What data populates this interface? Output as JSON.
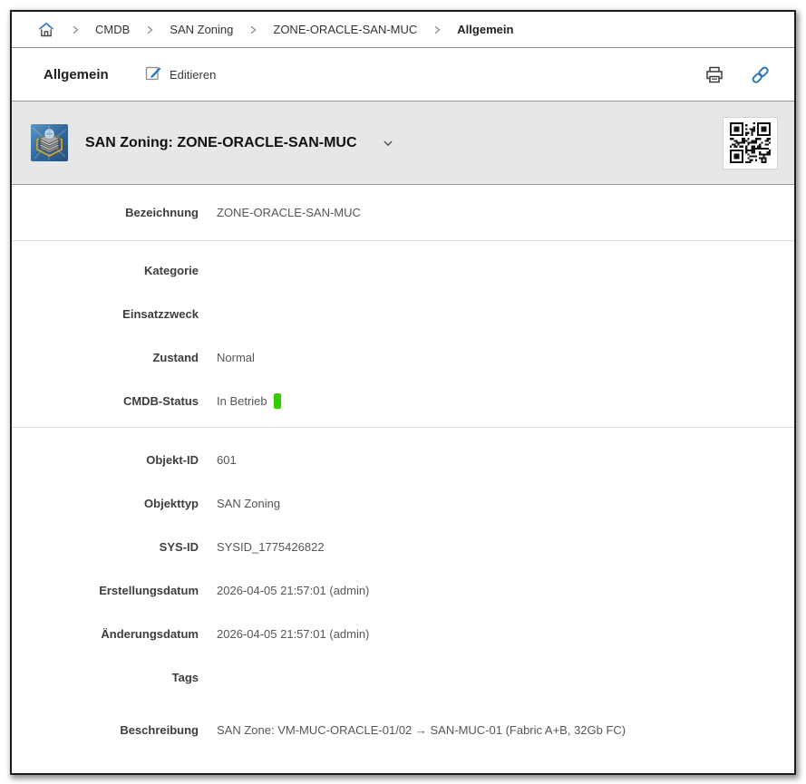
{
  "breadcrumb": {
    "items": [
      "CMDB",
      "SAN Zoning",
      "ZONE-ORACLE-SAN-MUC",
      "Allgemein"
    ]
  },
  "header": {
    "title": "Allgemein",
    "edit_label": "Editieren"
  },
  "object_header": {
    "title": "SAN Zoning: ZONE-ORACLE-SAN-MUC",
    "icons": [
      "object-type-icon",
      "chevron-down-icon",
      "qr-code"
    ]
  },
  "colors": {
    "status_badge_green": "#33cc00",
    "accent_blue": "#2a72b8",
    "band_gray": "#e7e7e7"
  },
  "form": {
    "sections": [
      {
        "rows": [
          {
            "label": "Bezeichnung",
            "value": "ZONE-ORACLE-SAN-MUC"
          }
        ]
      },
      {
        "rows": [
          {
            "label": "Kategorie",
            "value": ""
          },
          {
            "label": "Einsatzzweck",
            "value": ""
          },
          {
            "label": "Zustand",
            "value": "Normal"
          },
          {
            "label": "CMDB-Status",
            "value": "In Betrieb",
            "badge_color": "#33cc00"
          }
        ]
      },
      {
        "rows": [
          {
            "label": "Objekt-ID",
            "value": "601"
          },
          {
            "label": "Objekttyp",
            "value": "SAN Zoning"
          },
          {
            "label": "SYS-ID",
            "value": "SYSID_1775426822"
          },
          {
            "label": "Erstellungsdatum",
            "value": "2026-04-05 21:57:01 (admin)"
          },
          {
            "label": "Änderungsdatum",
            "value": "2026-04-05 21:57:01 (admin)"
          },
          {
            "label": "Tags",
            "value": ""
          },
          {
            "label": "Beschreibung",
            "value": "SAN Zone: VM-MUC-ORACLE-01/02 → SAN-MUC-01 (Fabric A+B, 32Gb FC)"
          }
        ]
      }
    ]
  }
}
